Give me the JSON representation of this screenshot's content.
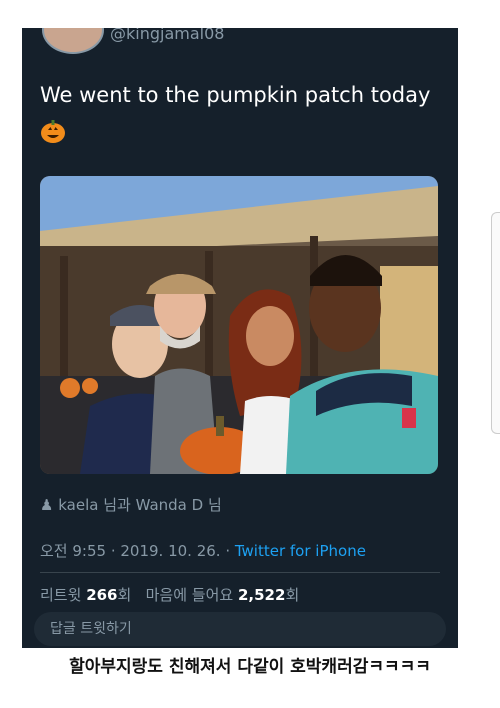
{
  "tweet": {
    "handle": "@kingjamal08",
    "text": "We went to the pumpkin patch today",
    "emoji": "jack-o-lantern-icon",
    "tagged": "kaela 님과 Wanda D 님",
    "time": "오전 9:55 · 2019. 10. 26. · ",
    "source": "Twitter for iPhone",
    "stats": {
      "retweet_label": "리트윗",
      "retweet_count": "266",
      "retweet_unit": "회",
      "like_label": "마음에 들어요",
      "like_count": "2,522",
      "like_unit": "회"
    },
    "reply_placeholder": "답글 트윗하기"
  },
  "caption": "할아부지랑도 친해져서 다같이 호박캐러감ㅋㅋㅋㅋ",
  "colors": {
    "background": "#15202b",
    "accent": "#1da1f2",
    "muted": "#8899a6"
  }
}
